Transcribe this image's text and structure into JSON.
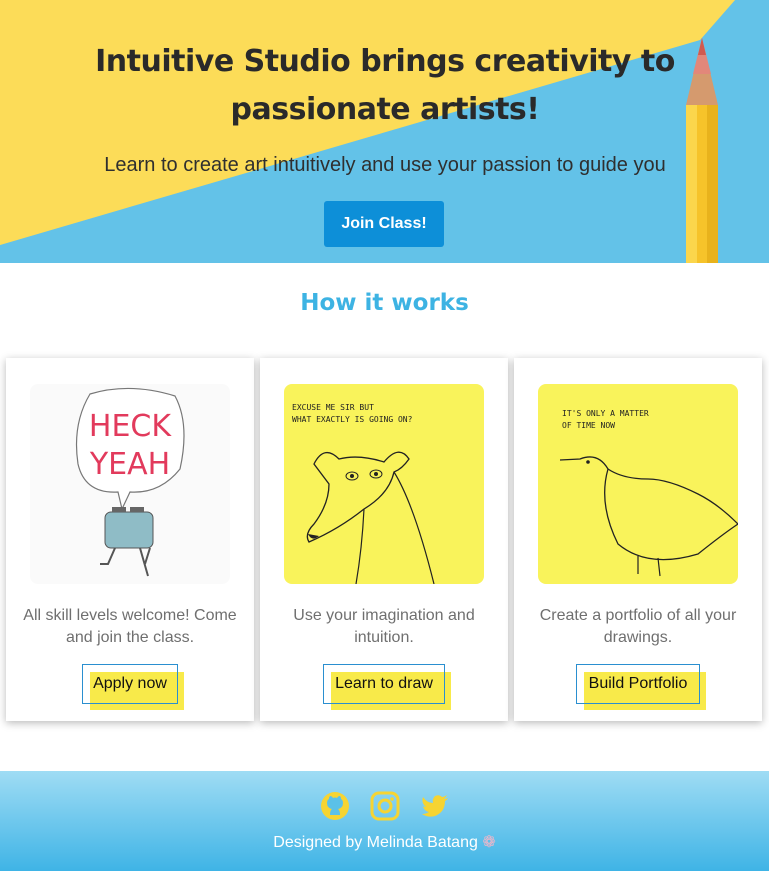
{
  "hero": {
    "title": "Intuitive Studio brings creativity to passionate artists!",
    "subtitle": "Learn to create art intuitively and use your passion to guide you",
    "cta_label": "Join Class!"
  },
  "how": {
    "title": "How it works",
    "cards": [
      {
        "image": "heck-yeah-toaster-drawing",
        "text": "All skill levels welcome! Come and join the class.",
        "button": "Apply now"
      },
      {
        "image": "dog-drawing",
        "text": "Use your imagination and intuition.",
        "button": "Learn to draw"
      },
      {
        "image": "bird-drawing",
        "text": "Create a portfolio of all your drawings.",
        "button": "Build Portfolio"
      }
    ]
  },
  "drawings": {
    "heck_yeah_line1": "HECK",
    "heck_yeah_line2": "YEAH",
    "dog_caption_1": "EXCUSE ME SIR BUT",
    "dog_caption_2": "WHAT EXACTLY IS GOING ON?",
    "bird_caption_1": "IT'S ONLY A MATTER",
    "bird_caption_2": "OF TIME NOW"
  },
  "footer": {
    "icons": [
      "github-icon",
      "instagram-icon",
      "twitter-icon"
    ],
    "credit": "Designed by Melinda Batang",
    "credit_emoji": "❁"
  },
  "colors": {
    "accent": "#0d8fd8",
    "heading_blue": "#3db3e3",
    "highlight_yellow": "#f8ea4a",
    "icon_yellow": "#f6d432"
  }
}
